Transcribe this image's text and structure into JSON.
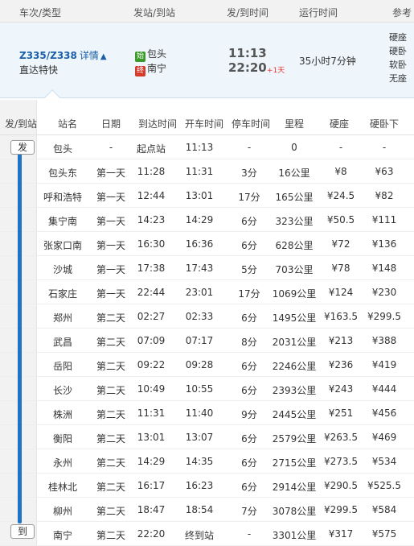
{
  "header": {
    "col_train": "车次/类型",
    "col_from_to": "发站/到站",
    "col_times": "发/到时间",
    "col_duration": "运行时间",
    "col_ref": "参考"
  },
  "train": {
    "code": "Z335/Z338",
    "detail_label": "详情",
    "type": "直达特快",
    "start_badge": "始",
    "start_station": "包头",
    "end_badge": "终",
    "end_station": "南宁",
    "dep_time": "11:13",
    "arr_time": "22:20",
    "plus_day": "+1天",
    "duration": "35小时7分钟",
    "fare_types": [
      "硬座",
      "硬卧",
      "软卧",
      "无座"
    ]
  },
  "table": {
    "headers": [
      "发/到站",
      "站名",
      "日期",
      "到达时间",
      "开车时间",
      "停车时间",
      "里程",
      "硬座",
      "硬卧下"
    ],
    "dep_tag": "发",
    "arr_tag": "到",
    "rows": [
      [
        "包头",
        "-",
        "起点站",
        "11:13",
        "-",
        "0",
        "-",
        "-"
      ],
      [
        "包头东",
        "第一天",
        "11:28",
        "11:31",
        "3分",
        "16公里",
        "¥8",
        "¥63"
      ],
      [
        "呼和浩特",
        "第一天",
        "12:44",
        "13:01",
        "17分",
        "165公里",
        "¥24.5",
        "¥82"
      ],
      [
        "集宁南",
        "第一天",
        "14:23",
        "14:29",
        "6分",
        "323公里",
        "¥50.5",
        "¥111"
      ],
      [
        "张家口南",
        "第一天",
        "16:30",
        "16:36",
        "6分",
        "628公里",
        "¥72",
        "¥136"
      ],
      [
        "沙城",
        "第一天",
        "17:38",
        "17:43",
        "5分",
        "703公里",
        "¥78",
        "¥148"
      ],
      [
        "石家庄",
        "第一天",
        "22:44",
        "23:01",
        "17分",
        "1069公里",
        "¥124",
        "¥230"
      ],
      [
        "郑州",
        "第二天",
        "02:27",
        "02:33",
        "6分",
        "1495公里",
        "¥163.5",
        "¥299.5"
      ],
      [
        "武昌",
        "第二天",
        "07:09",
        "07:17",
        "8分",
        "2031公里",
        "¥213",
        "¥388"
      ],
      [
        "岳阳",
        "第二天",
        "09:22",
        "09:28",
        "6分",
        "2246公里",
        "¥236",
        "¥419"
      ],
      [
        "长沙",
        "第二天",
        "10:49",
        "10:55",
        "6分",
        "2393公里",
        "¥243",
        "¥444"
      ],
      [
        "株洲",
        "第二天",
        "11:31",
        "11:40",
        "9分",
        "2445公里",
        "¥251",
        "¥456"
      ],
      [
        "衡阳",
        "第二天",
        "13:01",
        "13:07",
        "6分",
        "2579公里",
        "¥263.5",
        "¥469"
      ],
      [
        "永州",
        "第二天",
        "14:29",
        "14:35",
        "6分",
        "2715公里",
        "¥273.5",
        "¥534"
      ],
      [
        "桂林北",
        "第二天",
        "16:17",
        "16:23",
        "6分",
        "2914公里",
        "¥290.5",
        "¥525.5"
      ],
      [
        "柳州",
        "第二天",
        "18:47",
        "18:54",
        "7分",
        "3078公里",
        "¥299.5",
        "¥584"
      ],
      [
        "南宁",
        "第二天",
        "22:20",
        "终到站",
        "-",
        "3301公里",
        "¥317",
        "¥575"
      ]
    ]
  },
  "colors": {
    "accent": "#1a5fa8",
    "track": "#1e74c8",
    "start_badge": "#3a9a2a",
    "end_badge": "#d43b2a",
    "plus_day": "#e33333"
  }
}
